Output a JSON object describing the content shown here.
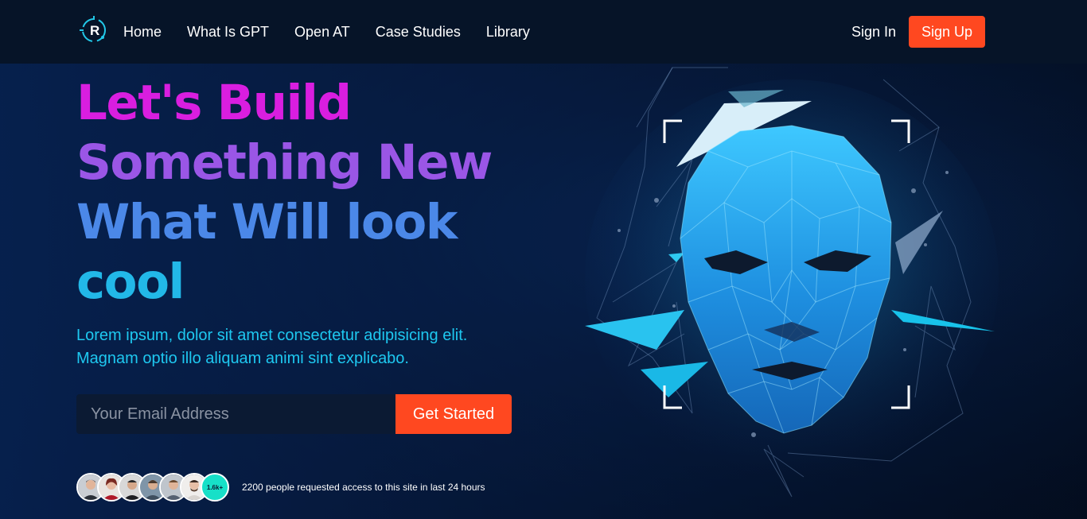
{
  "header": {
    "logo_text": "R",
    "nav": [
      {
        "label": "Home"
      },
      {
        "label": "What Is GPT"
      },
      {
        "label": "Open AT"
      },
      {
        "label": "Case Studies"
      },
      {
        "label": "Library"
      }
    ],
    "sign_in": "Sign In",
    "sign_up": "Sign Up"
  },
  "hero": {
    "title_lines": [
      "Let's Build",
      "Something New",
      "What Will look",
      "cool"
    ],
    "description_lines": [
      "Lorem ipsum, dolor sit amet consectetur adipisicing elit.",
      "Magnam optio illo aliquam animi sint explicabo."
    ],
    "email_placeholder": "Your Email Address",
    "cta": "Get Started",
    "avatar_count_badge": "1.6k+",
    "social_proof": "2200 people requested access to this site in last 24 hours"
  },
  "colors": {
    "accent": "#ff4820",
    "title_line1": "#d91ee0",
    "title_line2": "#9a56e6",
    "title_line3": "#4b88e8",
    "title_line4": "#22b8e8",
    "description": "#1ec8f0",
    "badge": "#17e0c8"
  },
  "icons": [
    "logo-icon",
    "polygon-face-illustration"
  ]
}
